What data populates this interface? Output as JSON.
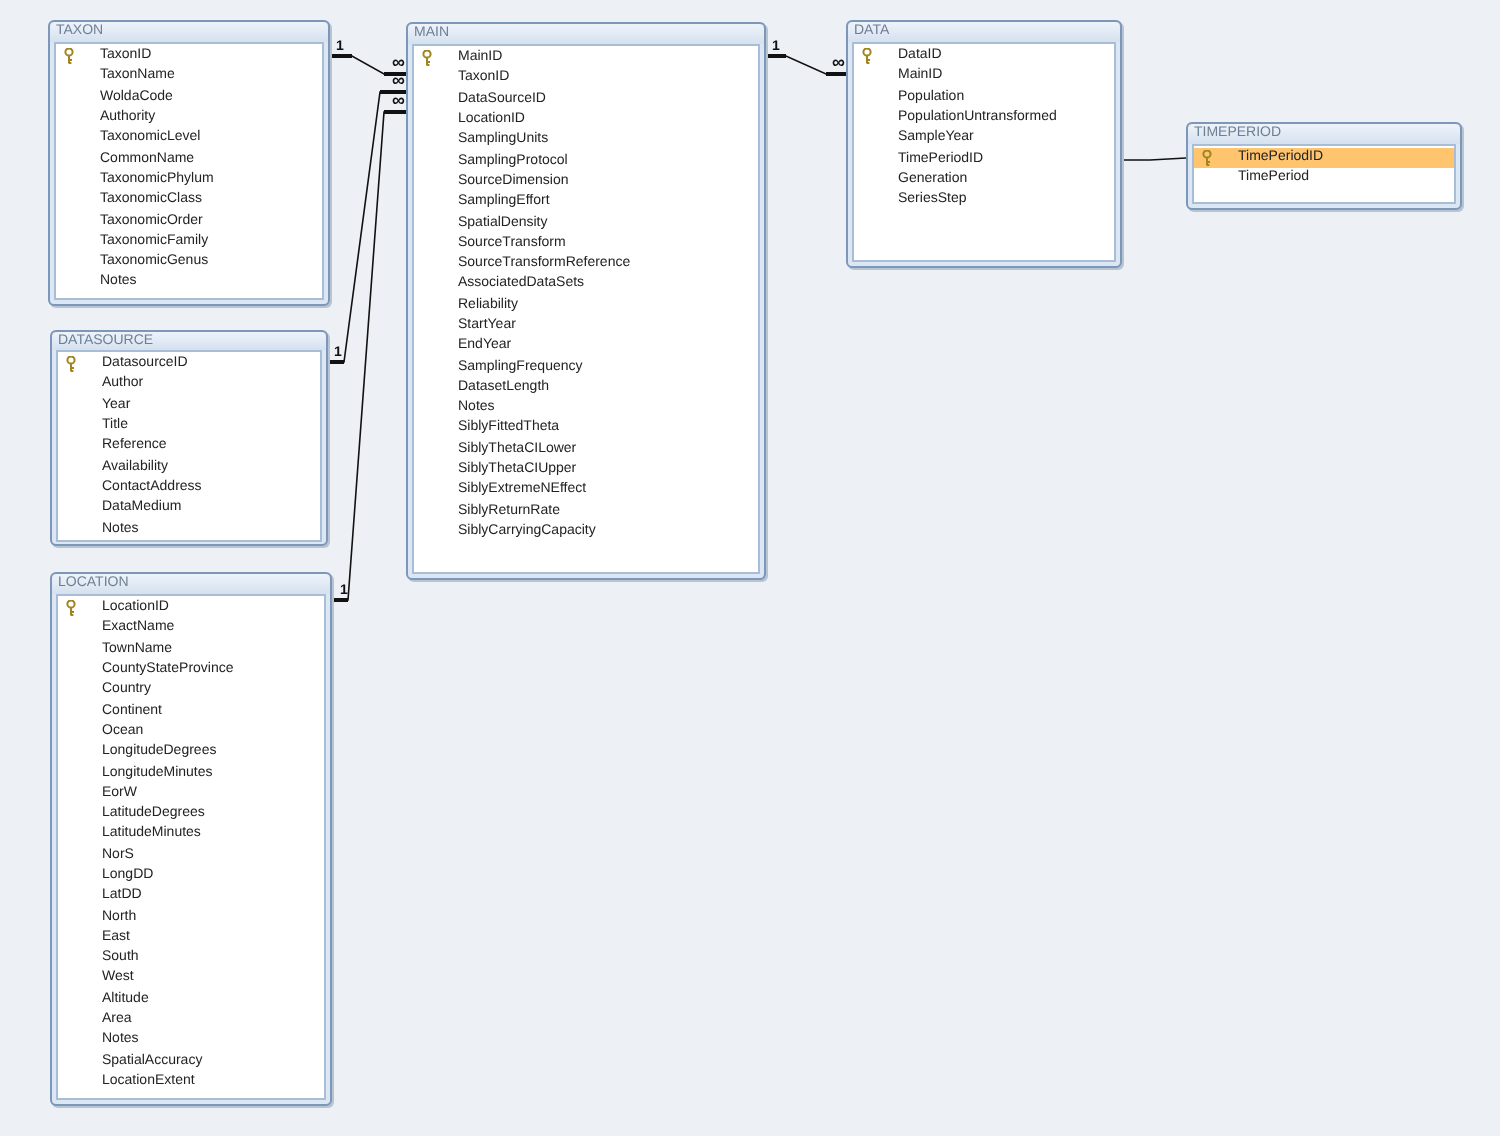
{
  "tables": [
    {
      "name": "TAXON",
      "fields": [
        {
          "name": "TaxonID",
          "key": true,
          "selected": false
        },
        {
          "name": "TaxonName",
          "key": false,
          "selected": false
        },
        {
          "name": "WoldaCode",
          "key": false,
          "selected": false
        },
        {
          "name": "Authority",
          "key": false,
          "selected": false
        },
        {
          "name": "TaxonomicLevel",
          "key": false,
          "selected": false
        },
        {
          "name": "CommonName",
          "key": false,
          "selected": false
        },
        {
          "name": "TaxonomicPhylum",
          "key": false,
          "selected": false
        },
        {
          "name": "TaxonomicClass",
          "key": false,
          "selected": false
        },
        {
          "name": "TaxonomicOrder",
          "key": false,
          "selected": false
        },
        {
          "name": "TaxonomicFamily",
          "key": false,
          "selected": false
        },
        {
          "name": "TaxonomicGenus",
          "key": false,
          "selected": false
        },
        {
          "name": "Notes",
          "key": false,
          "selected": false
        }
      ]
    },
    {
      "name": "DATASOURCE",
      "fields": [
        {
          "name": "DatasourceID",
          "key": true,
          "selected": false
        },
        {
          "name": "Author",
          "key": false,
          "selected": false
        },
        {
          "name": "Year",
          "key": false,
          "selected": false
        },
        {
          "name": "Title",
          "key": false,
          "selected": false
        },
        {
          "name": "Reference",
          "key": false,
          "selected": false
        },
        {
          "name": "Availability",
          "key": false,
          "selected": false
        },
        {
          "name": "ContactAddress",
          "key": false,
          "selected": false
        },
        {
          "name": "DataMedium",
          "key": false,
          "selected": false
        },
        {
          "name": "Notes",
          "key": false,
          "selected": false
        }
      ]
    },
    {
      "name": "LOCATION",
      "fields": [
        {
          "name": "LocationID",
          "key": true,
          "selected": false
        },
        {
          "name": "ExactName",
          "key": false,
          "selected": false
        },
        {
          "name": "TownName",
          "key": false,
          "selected": false
        },
        {
          "name": "CountyStateProvince",
          "key": false,
          "selected": false
        },
        {
          "name": "Country",
          "key": false,
          "selected": false
        },
        {
          "name": "Continent",
          "key": false,
          "selected": false
        },
        {
          "name": "Ocean",
          "key": false,
          "selected": false
        },
        {
          "name": "LongitudeDegrees",
          "key": false,
          "selected": false
        },
        {
          "name": "LongitudeMinutes",
          "key": false,
          "selected": false
        },
        {
          "name": "EorW",
          "key": false,
          "selected": false
        },
        {
          "name": "LatitudeDegrees",
          "key": false,
          "selected": false
        },
        {
          "name": "LatitudeMinutes",
          "key": false,
          "selected": false
        },
        {
          "name": "NorS",
          "key": false,
          "selected": false
        },
        {
          "name": "LongDD",
          "key": false,
          "selected": false
        },
        {
          "name": "LatDD",
          "key": false,
          "selected": false
        },
        {
          "name": "North",
          "key": false,
          "selected": false
        },
        {
          "name": "East",
          "key": false,
          "selected": false
        },
        {
          "name": "South",
          "key": false,
          "selected": false
        },
        {
          "name": "West",
          "key": false,
          "selected": false
        },
        {
          "name": "Altitude",
          "key": false,
          "selected": false
        },
        {
          "name": "Area",
          "key": false,
          "selected": false
        },
        {
          "name": "Notes",
          "key": false,
          "selected": false
        },
        {
          "name": "SpatialAccuracy",
          "key": false,
          "selected": false
        },
        {
          "name": "LocationExtent",
          "key": false,
          "selected": false
        }
      ]
    },
    {
      "name": "MAIN",
      "fields": [
        {
          "name": "MainID",
          "key": true,
          "selected": false
        },
        {
          "name": "TaxonID",
          "key": false,
          "selected": false
        },
        {
          "name": "DataSourceID",
          "key": false,
          "selected": false
        },
        {
          "name": "LocationID",
          "key": false,
          "selected": false
        },
        {
          "name": "SamplingUnits",
          "key": false,
          "selected": false
        },
        {
          "name": "SamplingProtocol",
          "key": false,
          "selected": false
        },
        {
          "name": "SourceDimension",
          "key": false,
          "selected": false
        },
        {
          "name": "SamplingEffort",
          "key": false,
          "selected": false
        },
        {
          "name": "SpatialDensity",
          "key": false,
          "selected": false
        },
        {
          "name": "SourceTransform",
          "key": false,
          "selected": false
        },
        {
          "name": "SourceTransformReference",
          "key": false,
          "selected": false
        },
        {
          "name": "AssociatedDataSets",
          "key": false,
          "selected": false
        },
        {
          "name": "Reliability",
          "key": false,
          "selected": false
        },
        {
          "name": "StartYear",
          "key": false,
          "selected": false
        },
        {
          "name": "EndYear",
          "key": false,
          "selected": false
        },
        {
          "name": "SamplingFrequency",
          "key": false,
          "selected": false
        },
        {
          "name": "DatasetLength",
          "key": false,
          "selected": false
        },
        {
          "name": "Notes",
          "key": false,
          "selected": false
        },
        {
          "name": "SiblyFittedTheta",
          "key": false,
          "selected": false
        },
        {
          "name": "SiblyThetaCILower",
          "key": false,
          "selected": false
        },
        {
          "name": "SiblyThetaCIUpper",
          "key": false,
          "selected": false
        },
        {
          "name": "SiblyExtremeNEffect",
          "key": false,
          "selected": false
        },
        {
          "name": "SiblyReturnRate",
          "key": false,
          "selected": false
        },
        {
          "name": "SiblyCarryingCapacity",
          "key": false,
          "selected": false
        }
      ]
    },
    {
      "name": "DATA",
      "fields": [
        {
          "name": "DataID",
          "key": true,
          "selected": false
        },
        {
          "name": "MainID",
          "key": false,
          "selected": false
        },
        {
          "name": "Population",
          "key": false,
          "selected": false
        },
        {
          "name": "PopulationUntransformed",
          "key": false,
          "selected": false
        },
        {
          "name": "SampleYear",
          "key": false,
          "selected": false
        },
        {
          "name": "TimePeriodID",
          "key": false,
          "selected": false
        },
        {
          "name": "Generation",
          "key": false,
          "selected": false
        },
        {
          "name": "SeriesStep",
          "key": false,
          "selected": false
        }
      ]
    },
    {
      "name": "TIMEPERIOD",
      "fields": [
        {
          "name": "TimePeriodID",
          "key": true,
          "selected": true
        },
        {
          "name": "TimePeriod",
          "key": false,
          "selected": false
        }
      ]
    }
  ],
  "relationships": [
    {
      "enforced": true,
      "one_label": "1",
      "many_label": "∞"
    },
    {
      "enforced": true,
      "one_label": "1",
      "many_label": "∞"
    },
    {
      "enforced": true,
      "one_label": "1",
      "many_label": "∞"
    },
    {
      "enforced": true,
      "one_label": "1",
      "many_label": "∞"
    },
    {
      "enforced": false
    }
  ]
}
